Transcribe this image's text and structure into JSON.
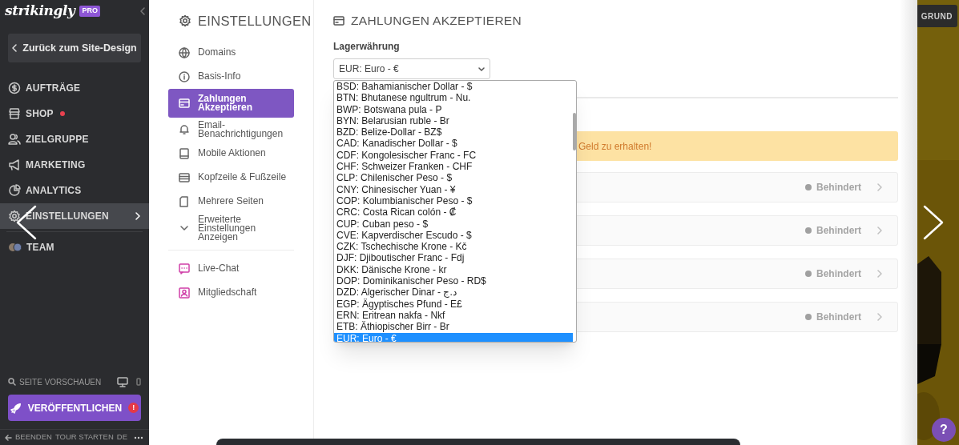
{
  "sidebar": {
    "logo": "strikingly",
    "badge": "PRO",
    "back_button": "Zurück zum Site-Design",
    "items": [
      {
        "label": "AUFTRÄGE",
        "selected": false,
        "notification": false
      },
      {
        "label": "SHOP",
        "selected": false,
        "notification": true
      },
      {
        "label": "ZIELGRUPPE",
        "selected": false,
        "notification": false
      },
      {
        "label": "MARKETING",
        "selected": false,
        "notification": false
      },
      {
        "label": "ANALYTICS",
        "selected": false,
        "notification": false
      },
      {
        "label": "EINSTELLUNGEN",
        "selected": true,
        "notification": false
      },
      {
        "label": "TEAM",
        "selected": false,
        "notification": false
      }
    ],
    "preview": "SEITE VORSCHAUEN",
    "publish_button": "VERÖFFENTLICHEN",
    "publish_alert": "!",
    "footer": [
      "BEENDEN",
      "TOUR STARTEN",
      "DE"
    ]
  },
  "settings_nav": {
    "title": "EINSTELLUNGEN",
    "items": [
      {
        "label": "Domains",
        "selected": false,
        "kind": "link"
      },
      {
        "label": "Basis-Info",
        "selected": false,
        "kind": "link"
      },
      {
        "label": "Zahlungen Akzeptieren",
        "selected": true,
        "kind": "link"
      },
      {
        "label": "Email-Benachrichtigungen",
        "selected": false,
        "kind": "link"
      },
      {
        "label": "Mobile Aktionen",
        "selected": false,
        "kind": "link"
      },
      {
        "label": "Kopfzeile & Fußzeile",
        "selected": false,
        "kind": "link"
      },
      {
        "label": "Mehrere Seiten",
        "selected": false,
        "kind": "link"
      },
      {
        "label": "Erweiterte Einstellungen Anzeigen",
        "selected": false,
        "kind": "expander"
      },
      {
        "label": "Live-Chat",
        "selected": false,
        "kind": "app"
      },
      {
        "label": "Mitgliedschaft",
        "selected": false,
        "kind": "app"
      }
    ]
  },
  "main": {
    "title": "ZAHLUNGEN AKZEPTIEREN",
    "currency_label": "Lagerwährung",
    "currency_value": "EUR: Euro - €",
    "options": [
      {
        "label": "BSD: Bahamianischer Dollar - $",
        "selected": false
      },
      {
        "label": "BTN: Bhutanese ngultrum - Nu.",
        "selected": false
      },
      {
        "label": "BWP: Botswana pula - P",
        "selected": false
      },
      {
        "label": "BYN: Belarusian ruble - Br",
        "selected": false
      },
      {
        "label": "BZD: Belize-Dollar - BZ$",
        "selected": false
      },
      {
        "label": "CAD: Kanadischer Dollar - $",
        "selected": false
      },
      {
        "label": "CDF: Kongolesischer Franc - FC",
        "selected": false
      },
      {
        "label": "CHF: Schweizer Franken - CHF",
        "selected": false
      },
      {
        "label": "CLP: Chilenischer Peso - $",
        "selected": false
      },
      {
        "label": "CNY: Chinesischer Yuan - ¥",
        "selected": false
      },
      {
        "label": "COP: Kolumbianischer Peso - $",
        "selected": false
      },
      {
        "label": "CRC: Costa Rican colón - ₡",
        "selected": false
      },
      {
        "label": "CUP: Cuban peso - $",
        "selected": false
      },
      {
        "label": "CVE: Kapverdischer Escudo - $",
        "selected": false
      },
      {
        "label": "CZK: Tschechische Krone - Kč",
        "selected": false
      },
      {
        "label": "DJF: Djiboutischer Franc - Fdj",
        "selected": false
      },
      {
        "label": "DKK: Dänische Krone - kr",
        "selected": false
      },
      {
        "label": "DOP: Dominikanischer Peso - RD$",
        "selected": false
      },
      {
        "label": "DZD: Algerischer Dinar - د.ج",
        "selected": false
      },
      {
        "label": "EGP: Ägyptisches Pfund - E£",
        "selected": false
      },
      {
        "label": "ERN: Eritrean nakfa - Nkf",
        "selected": false
      },
      {
        "label": "ETB: Äthiopischer Birr - Br",
        "selected": false
      },
      {
        "label": "EUR: Euro - €",
        "selected": true
      }
    ],
    "notice": "Geld zu erhalten!",
    "providers": [
      {
        "status": "Behindert"
      },
      {
        "status": "Behindert"
      },
      {
        "status": "Behindert"
      },
      {
        "status": "Behindert"
      }
    ]
  },
  "background_button": "GRUND",
  "help": "?"
}
